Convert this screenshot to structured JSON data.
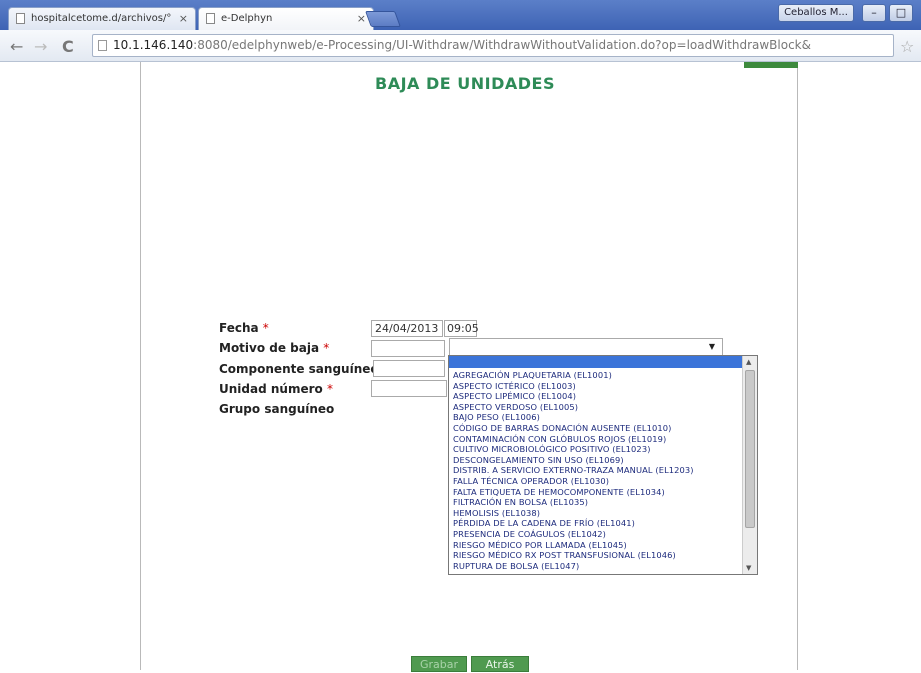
{
  "browser": {
    "tabs": [
      {
        "label": "hospitalcetome.d/archivos/°"
      },
      {
        "label": "e-Delphyn"
      }
    ],
    "tab_close": "×",
    "user_button": "Ceballos M...",
    "minimize": "–",
    "restore": "□",
    "url_host": "10.1.146.140",
    "url_rest": ":8080/edelphynweb/e-Processing/UI-Withdraw/WithdrawWithoutValidation.do?op=loadWithdrawBlock&"
  },
  "page": {
    "title": "BAJA DE UNIDADES",
    "form": {
      "fecha_label": "Fecha",
      "fecha_date": "24/04/2013",
      "fecha_time": "09:05",
      "motivo_label": "Motivo de baja",
      "componente_label": "Componente sanguíneo",
      "unidad_label": "Unidad número",
      "grupo_label": "Grupo sanguíneo",
      "required_mark": "*"
    },
    "motivo_options": [
      "AGREGACIÓN PLAQUETARIA (EL1001)",
      "ASPECTO ICTÉRICO (EL1003)",
      "ASPECTO LIPÉMICO (EL1004)",
      "ASPECTO VERDOSO (EL1005)",
      "BAJO PESO (EL1006)",
      "CÓDIGO DE BARRAS DONACIÓN AUSENTE (EL1010)",
      "CONTAMINACIÓN CON GLÓBULOS ROJOS (EL1019)",
      "CULTIVO MICROBIOLÓGICO POSITIVO (EL1023)",
      "DESCONGELAMIENTO SIN USO (EL1069)",
      "DISTRIB. A SERVICIO EXTERNO-TRAZA MANUAL (EL1203)",
      "FALLA TÉCNICA OPERADOR (EL1030)",
      "FALTA ETIQUETA DE HEMOCOMPONENTE (EL1034)",
      "FILTRACIÓN EN BOLSA (EL1035)",
      "HEMOLISIS (EL1038)",
      "PÉRDIDA DE LA CADENA DE FRÍO (EL1041)",
      "PRESENCIA DE COÁGULOS (EL1042)",
      "RIESGO MÉDICO POR LLAMADA (EL1045)",
      "RIESGO MÉDICO RX POST TRANSFUSIONAL (EL1046)",
      "RUPTURA DE BOLSA (EL1047)"
    ],
    "buttons": {
      "grabar": "Grabar",
      "atras": "Atrás"
    }
  },
  "colors": {
    "title_green": "#2e8b57",
    "button_green": "#4f9a4f",
    "dropdown_text": "#1c2a7c",
    "selection_blue": "#3b74d9"
  }
}
